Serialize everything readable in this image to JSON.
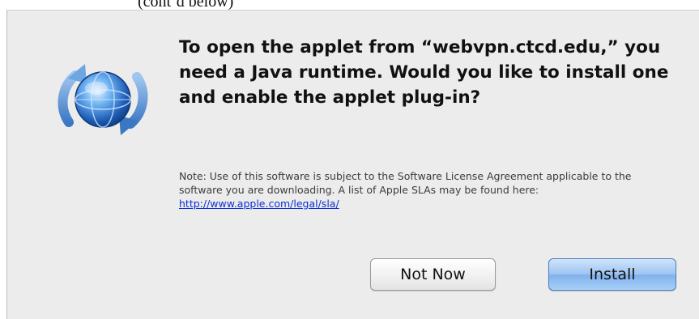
{
  "top_fragment": "(cont’d below)",
  "dialog": {
    "headline": "To open the applet from “webvpn.ctcd.edu,” you need a Java runtime. Would you like to install one and enable the applet plug-in?",
    "note_text": "Note: Use of this software is subject to the Software License Agreement applicable to the software you are downloading. A list of Apple SLAs may be found here: ",
    "note_link": "http://www.apple.com/legal/sla/",
    "icon": "software-update-icon",
    "buttons": {
      "not_now": "Not Now",
      "install": "Install"
    }
  },
  "colors": {
    "dialog_bg": "#ececec",
    "link": "#0b2fd6",
    "default_button": "#9cc4f1"
  }
}
